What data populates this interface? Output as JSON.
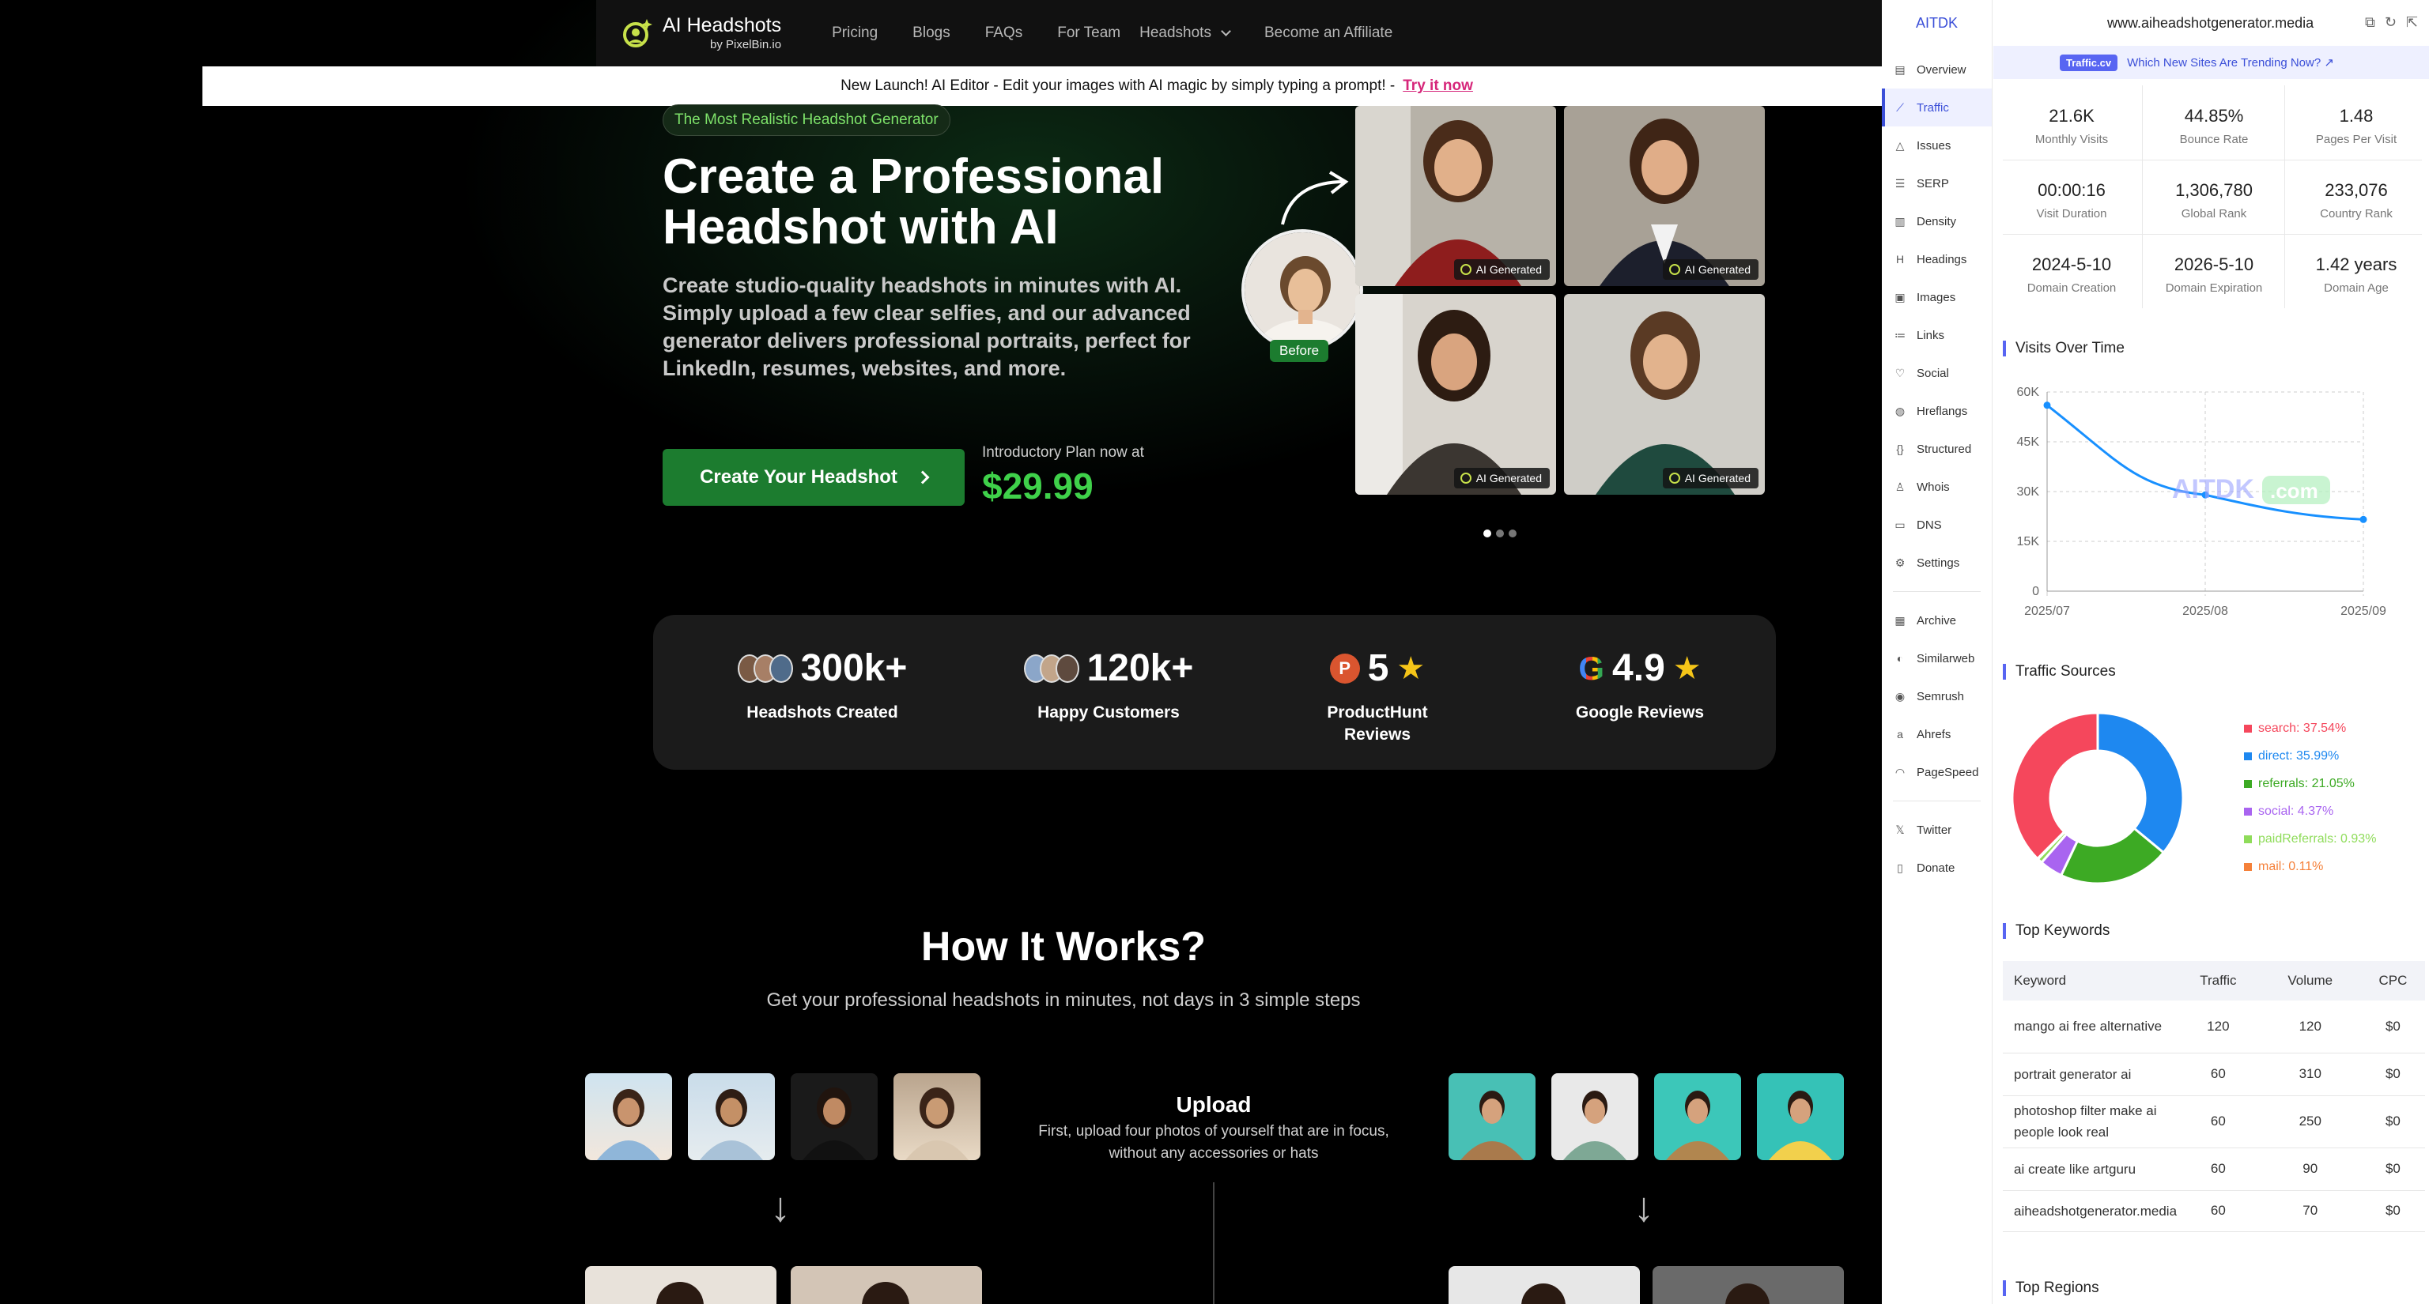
{
  "site": {
    "logo": {
      "title": "AI Headshots",
      "sub": "by PixelBin.io"
    },
    "nav": [
      "Pricing",
      "Blogs",
      "FAQs",
      "For Team",
      "Headshots",
      "Become an Affiliate"
    ],
    "banner": {
      "text": "New Launch! AI Editor - Edit your images with AI magic by simply typing a prompt! -",
      "link": "Try it now"
    },
    "hero": {
      "pill": "The Most Realistic Headshot Generator",
      "title": "Create a Professional Headshot with AI",
      "desc": "Create studio-quality headshots in minutes with AI. Simply upload a few clear selfies, and our advanced generator delivers professional portraits, perfect for LinkedIn, resumes, websites, and more.",
      "cta": "Create Your Headshot",
      "intro": "Introductory Plan now at",
      "price": "$29.99",
      "badge": "AI Generated",
      "before": "Before"
    },
    "stats": [
      {
        "value": "300k+",
        "label": "Headshots Created"
      },
      {
        "value": "120k+",
        "label": "Happy Customers"
      },
      {
        "value": "5",
        "label": "ProductHunt Reviews",
        "icon": "P"
      },
      {
        "value": "4.9",
        "label": "Google Reviews",
        "icon": "G"
      }
    ],
    "how": {
      "title": "How It Works?",
      "sub": "Get your professional headshots in minutes, not days in 3 simple steps",
      "step_title": "Upload",
      "step_desc": "First, upload four photos of yourself that are in focus, without any accessories or hats"
    }
  },
  "ext": {
    "brand": "AITDK",
    "domain": "www.aiheadshotgenerator.media",
    "menu": [
      "Overview",
      "Traffic",
      "Issues",
      "SERP",
      "Density",
      "Headings",
      "Images",
      "Links",
      "Social",
      "Hreflangs",
      "Structured",
      "Whois",
      "DNS",
      "Settings"
    ],
    "menu2": [
      "Archive",
      "Similarweb",
      "Semrush",
      "Ahrefs",
      "PageSpeed"
    ],
    "menu3": [
      "Twitter",
      "Donate"
    ],
    "promo": {
      "tag": "Traffic.cv",
      "text": "Which New Sites Are Trending Now? ↗"
    },
    "metrics": [
      {
        "v": "21.6K",
        "l": "Monthly Visits"
      },
      {
        "v": "44.85%",
        "l": "Bounce Rate"
      },
      {
        "v": "1.48",
        "l": "Pages Per Visit"
      },
      {
        "v": "00:00:16",
        "l": "Visit Duration"
      },
      {
        "v": "1,306,780",
        "l": "Global Rank"
      },
      {
        "v": "233,076",
        "l": "Country Rank"
      },
      {
        "v": "2024-5-10",
        "l": "Domain Creation"
      },
      {
        "v": "2026-5-10",
        "l": "Domain Expiration"
      },
      {
        "v": "1.42 years",
        "l": "Domain Age"
      }
    ],
    "sections": {
      "visits": "Visits Over Time",
      "sources": "Traffic Sources",
      "keywords": "Top Keywords",
      "regions": "Top Regions"
    },
    "watermark": "AITDK",
    "watermark_suffix": ".com",
    "keywords": {
      "headers": [
        "Keyword",
        "Traffic",
        "Volume",
        "CPC"
      ],
      "rows": [
        [
          "mango ai free alternative",
          "120",
          "120",
          "$0"
        ],
        [
          "portrait generator ai",
          "60",
          "310",
          "$0"
        ],
        [
          "photoshop filter make ai people look real",
          "60",
          "250",
          "$0"
        ],
        [
          "ai create like artguru",
          "60",
          "90",
          "$0"
        ],
        [
          "aiheadshotgenerator.media",
          "60",
          "70",
          "$0"
        ]
      ]
    }
  },
  "chart_data": [
    {
      "type": "line",
      "title": "Visits Over Time",
      "x": [
        "2025/07",
        "2025/08",
        "2025/09"
      ],
      "series": [
        {
          "values": [
            56000,
            29000,
            21600
          ]
        }
      ],
      "ylim": [
        0,
        60000
      ],
      "yticks": [
        "0",
        "15K",
        "30K",
        "45K",
        "60K"
      ],
      "grid": true,
      "color": "#1890ff"
    },
    {
      "type": "pie",
      "title": "Traffic Sources",
      "slices": [
        {
          "label": "search: 37.54%",
          "value": 37.54,
          "color": "#f5475c"
        },
        {
          "label": "direct: 35.99%",
          "value": 35.99,
          "color": "#1e88f0"
        },
        {
          "label": "referrals: 21.05%",
          "value": 21.05,
          "color": "#3daa24"
        },
        {
          "label": "social: 4.37%",
          "value": 4.37,
          "color": "#a964f0"
        },
        {
          "label": "paidReferrals: 0.93%",
          "value": 0.93,
          "color": "#8fdc5a"
        },
        {
          "label": "mail: 0.11%",
          "value": 0.11,
          "color": "#f5813a"
        }
      ]
    }
  ]
}
